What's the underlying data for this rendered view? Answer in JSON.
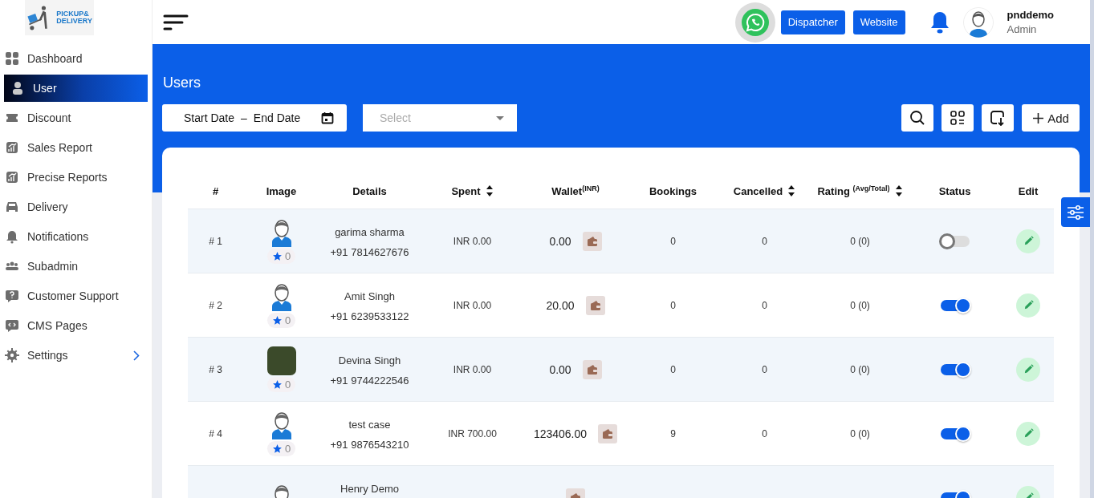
{
  "logo": {
    "line_1": "PICKUP&",
    "line_2": "DELIVERY"
  },
  "sidebar": {
    "items": [
      {
        "label": "Dashboard",
        "kind": "grid",
        "selected": false,
        "expandable": false
      },
      {
        "label": "User",
        "kind": "person",
        "selected": true,
        "expandable": false
      },
      {
        "label": "Discount",
        "kind": "ticket",
        "selected": false,
        "expandable": false
      },
      {
        "label": "Sales Report",
        "kind": "chart",
        "selected": false,
        "expandable": false
      },
      {
        "label": "Precise Reports",
        "kind": "chart",
        "selected": false,
        "expandable": false
      },
      {
        "label": "Delivery",
        "kind": "car",
        "selected": false,
        "expandable": false
      },
      {
        "label": "Notifications",
        "kind": "bell",
        "selected": false,
        "expandable": false
      },
      {
        "label": "Subadmin",
        "kind": "people",
        "selected": false,
        "expandable": false
      },
      {
        "label": "Customer Support",
        "kind": "help",
        "selected": false,
        "expandable": false
      },
      {
        "label": "CMS Pages",
        "kind": "code",
        "selected": false,
        "expandable": false
      },
      {
        "label": "Settings",
        "kind": "gear",
        "selected": false,
        "expandable": true
      }
    ]
  },
  "header": {
    "buttons": [
      "Dispatcher",
      "Website"
    ],
    "user": {
      "name": "pnddemo",
      "role": "Admin"
    }
  },
  "page_title": "Users",
  "filters": {
    "date_range": {
      "start": "Start Date",
      "separator": "–",
      "end": "End Date"
    },
    "select": {
      "placeholder": "Select"
    },
    "add_label": "Add"
  },
  "table": {
    "columns": [
      {
        "label": "#",
        "sortable": false
      },
      {
        "label": "Image",
        "sortable": false
      },
      {
        "label": "Details",
        "sortable": false
      },
      {
        "label": "Spent",
        "sortable": true
      },
      {
        "label": "Wallet$^{(INR)}$",
        "sortable": false
      },
      {
        "label": "Bookings",
        "sortable": false
      },
      {
        "label": "Cancelled",
        "sortable": true
      },
      {
        "label": "Rating $^{(Avg/Total)}$",
        "sortable": true
      },
      {
        "label": "Status",
        "sortable": false
      },
      {
        "label": "Edit",
        "sortable": false
      }
    ],
    "rows": [
      {
        "number": "# 1",
        "kind": "silhouette",
        "badge": "0",
        "name": "garima sharma",
        "phone": "+91 7814627676",
        "spent": "INR 0.00",
        "wallet": "0.00",
        "bookings": "0",
        "cancelled": "0",
        "rating": "0 (0)",
        "active": false
      },
      {
        "number": "# 2",
        "kind": "silhouette",
        "badge": "0",
        "name": "Amit Singh",
        "phone": "+91 6239533122",
        "spent": "INR 0.00",
        "wallet": "20.00",
        "bookings": "0",
        "cancelled": "0",
        "rating": "0 (0)",
        "active": true
      },
      {
        "number": "# 3",
        "kind": "photo",
        "badge": "0",
        "name": "Devina Singh",
        "phone": "+91 9744222546",
        "spent": "INR 0.00",
        "wallet": "0.00",
        "bookings": "0",
        "cancelled": "0",
        "rating": "0 (0)",
        "active": true
      },
      {
        "number": "# 4",
        "kind": "silhouette",
        "badge": "0",
        "name": "test case",
        "phone": "+91 9876543210",
        "spent": "INR 700.00",
        "wallet": "123406.00",
        "bookings": "9",
        "cancelled": "0",
        "rating": "0 (0)",
        "active": true
      },
      {
        "kind": "silhouette",
        "name": "Henry Demo",
        "active": true
      }
    ]
  }
}
